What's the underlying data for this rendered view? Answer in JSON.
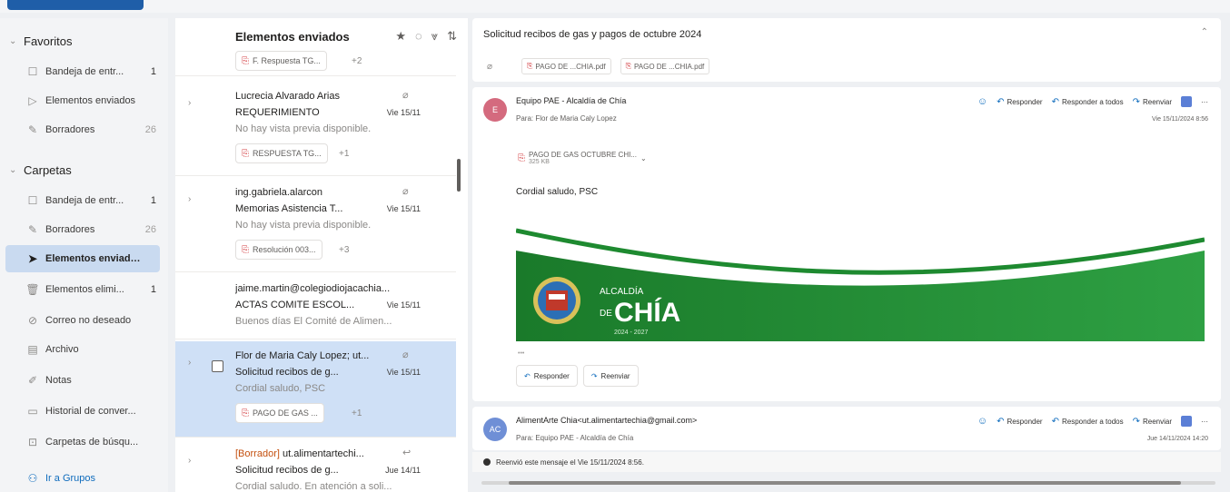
{
  "folders": {
    "favorites_label": "Favoritos",
    "favorites": [
      {
        "label": "Bandeja de entr...",
        "count": "1",
        "icon": "inbox-icon"
      },
      {
        "label": "Elementos enviados",
        "count": "",
        "icon": "send-icon"
      },
      {
        "label": "Borradores",
        "count": "26",
        "icon": "draft-icon"
      }
    ],
    "folders_label": "Carpetas",
    "items": [
      {
        "label": "Bandeja de entr...",
        "count": "1",
        "icon": "inbox-icon"
      },
      {
        "label": "Borradores",
        "count": "26",
        "icon": "draft-icon"
      },
      {
        "label": "Elementos enviados",
        "count": "",
        "icon": "send-icon",
        "selected": true
      },
      {
        "label": "Elementos elimi...",
        "count": "1",
        "icon": "trash-icon"
      },
      {
        "label": "Correo no deseado",
        "count": "",
        "icon": "junk-icon"
      },
      {
        "label": "Archivo",
        "count": "",
        "icon": "archive-icon"
      },
      {
        "label": "Notas",
        "count": "",
        "icon": "notes-icon"
      },
      {
        "label": "Historial de conver...",
        "count": "",
        "icon": "history-icon"
      },
      {
        "label": "Carpetas de búsqu...",
        "count": "",
        "icon": "search-folder-icon"
      }
    ],
    "groups_link": "Ir a Grupos"
  },
  "list": {
    "title": "Elementos enviados",
    "top_chip": "F. Respuesta TG...",
    "top_more": "+2",
    "messages": [
      {
        "sender": "Lucrecia Alvarado Arias",
        "draft": "",
        "subject": "REQUERIMIENTO",
        "date": "Vie 15/11",
        "preview": "No hay vista previa disponible.",
        "chip": "RESPUESTA TG...",
        "more": "+1",
        "clip": "⌀"
      },
      {
        "sender": "ing.gabriela.alarcon",
        "draft": "",
        "subject": "Memorias Asistencia T...",
        "date": "Vie 15/11",
        "preview": "No hay vista previa disponible.",
        "chip": "Resolución 003...",
        "more": "+3",
        "clip": "⌀"
      },
      {
        "sender": "jaime.martin@colegiodiojacachia...",
        "draft": "",
        "subject": "ACTAS COMITE ESCOL...",
        "date": "Vie 15/11",
        "preview": "Buenos días El Comité de Alimen...",
        "chip": "",
        "more": "",
        "clip": ""
      },
      {
        "sender": "Flor de Maria Caly Lopez; ut...",
        "draft": "",
        "subject": "Solicitud recibos de g...",
        "date": "Vie 15/11",
        "preview": "Cordial saludo, PSC",
        "chip": "PAGO DE GAS ...",
        "more": "+1",
        "clip": "⌀",
        "selected": true
      },
      {
        "sender": " ut.alimentartechi...",
        "draft": "[Borrador]",
        "subject": "Solicitud recibos de g...",
        "date": "Jue 14/11",
        "preview": "Cordial saludo. En atención a soli...",
        "chip": "",
        "more": "",
        "clip": "↩"
      }
    ]
  },
  "reading": {
    "subject": "Solicitud recibos de gas y pagos de octubre 2024",
    "attachments": [
      "PAGO DE ...CHIA.pdf",
      "PAGO DE ...CHIA.pdf"
    ],
    "message1": {
      "avatar": "E",
      "avatar_color": "#d46a7e",
      "from": "Equipo PAE - Alcaldía de Chía",
      "to": "Para: Flor de Maria Caly Lopez",
      "timestamp": "Vie 15/11/2024 8:56",
      "attachment": "PAGO DE GAS OCTUBRE CHI...",
      "attachment_size": "325 KB",
      "greeting": "Cordial saludo, PSC",
      "banner_line1": "ALCALDÍA",
      "banner_de": "DE",
      "banner_city": "CHÍA",
      "banner_years": "2024 - 2027",
      "ellipsis": "•••",
      "reply": "Responder",
      "forward": "Reenviar"
    },
    "actions": {
      "reply": "Responder",
      "reply_all": "Responder a todos",
      "forward": "Reenviar"
    },
    "message2": {
      "avatar": "AC",
      "avatar_color": "#6f8fd6",
      "from": "AlimentArte Chia<ut.alimentartechia@gmail.com>",
      "to": "Para: Equipo PAE - Alcaldía de Chía",
      "timestamp": "Jue 14/11/2024 14:20"
    },
    "forward_note": "Reenvió este mensaje el Vie 15/11/2024 8:56.",
    "accent": "#1f5ea8",
    "brand_green": "#1d8a2e"
  }
}
